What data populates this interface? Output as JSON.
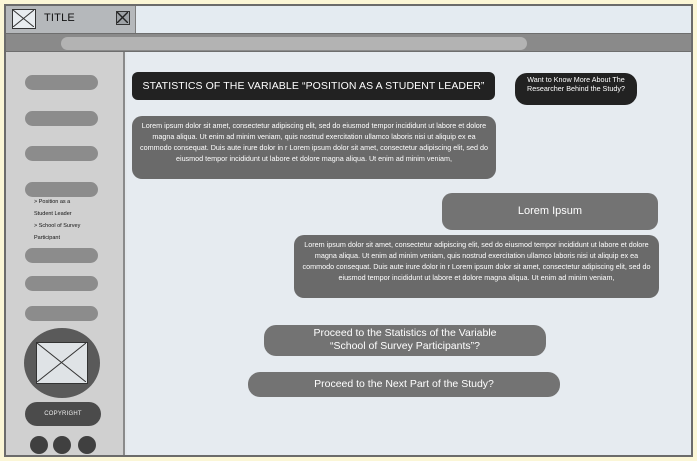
{
  "window": {
    "tab_title": "TITLE"
  },
  "sidebar": {
    "submenu_items": [
      "> Position as a",
      "Student Leader",
      "> School of Survey",
      "Participant"
    ],
    "copyright": "COPYRIGHT"
  },
  "main": {
    "stats_heading": "STATISTICS OF THE VARIABLE  “POSITION AS A STUDENT LEADER”",
    "researcher_button": "Want to Know More About The Researcher Behind the Study?",
    "paragraph_1": "Lorem ipsum dolor sit amet, consectetur adipiscing elit, sed do eiusmod tempor incididunt ut labore et dolore magna aliqua. Ut enim ad minim veniam, quis nostrud exercitation ullamco laboris nisi ut aliquip ex ea commodo consequat. Duis aute irure dolor in r Lorem ipsum dolor sit amet, consectetur adipiscing elit, sed do eiusmod tempor incididunt ut labore et dolore magna aliqua. Ut enim ad minim veniam,",
    "lorem_heading": "Lorem Ipsum",
    "paragraph_2": "Lorem ipsum dolor sit amet, consectetur adipiscing elit, sed do eiusmod tempor incididunt ut labore et dolore magna aliqua. Ut enim ad minim veniam, quis nostrud exercitation ullamco laboris nisi ut aliquip ex ea commodo consequat. Duis aute irure dolor in r Lorem ipsum dolor sit amet, consectetur adipiscing elit, sed do eiusmod tempor incididunt ut labore et dolore magna aliqua. Ut enim ad minim veniam,",
    "proceed_school_line1": "Proceed to the Statistics of the Variable",
    "proceed_school_line2": "“School of Survey Participants”?",
    "proceed_next": "Proceed to the Next Part of the Study?"
  },
  "icons": {
    "tab_image": "image-placeholder-icon",
    "tab_close": "close-icon",
    "avatar": "image-placeholder-icon"
  },
  "colors": {
    "background": "#fbf6d6",
    "dark_button": "#222222",
    "grey_box": "#6a6a6a"
  }
}
